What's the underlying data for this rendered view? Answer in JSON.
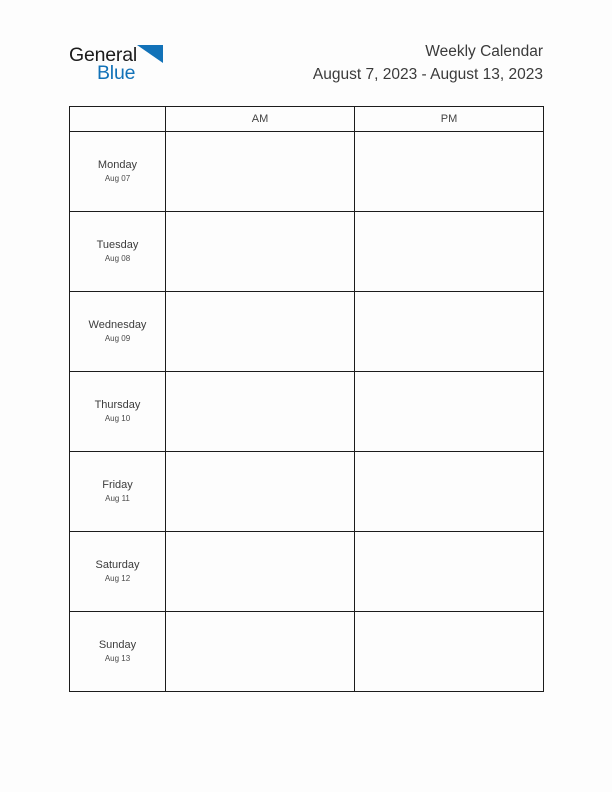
{
  "logo": {
    "word_top": "General",
    "word_bottom": "Blue",
    "triangle_icon": "triangle-icon",
    "brand_color": "#1272b8",
    "text_color": "#1b1b1b"
  },
  "header": {
    "title": "Weekly Calendar",
    "date_range": "August 7, 2023 - August 13, 2023"
  },
  "table": {
    "columns": [
      {
        "key": "day",
        "label": ""
      },
      {
        "key": "am",
        "label": "AM"
      },
      {
        "key": "pm",
        "label": "PM"
      }
    ],
    "rows": [
      {
        "day": "Monday",
        "date": "Aug 07",
        "am": "",
        "pm": ""
      },
      {
        "day": "Tuesday",
        "date": "Aug 08",
        "am": "",
        "pm": ""
      },
      {
        "day": "Wednesday",
        "date": "Aug 09",
        "am": "",
        "pm": ""
      },
      {
        "day": "Thursday",
        "date": "Aug 10",
        "am": "",
        "pm": ""
      },
      {
        "day": "Friday",
        "date": "Aug 11",
        "am": "",
        "pm": ""
      },
      {
        "day": "Saturday",
        "date": "Aug 12",
        "am": "",
        "pm": ""
      },
      {
        "day": "Sunday",
        "date": "Aug 13",
        "am": "",
        "pm": ""
      }
    ]
  },
  "page": {
    "background_color": "#fdfdfd",
    "border_color": "#1c1c1c"
  }
}
